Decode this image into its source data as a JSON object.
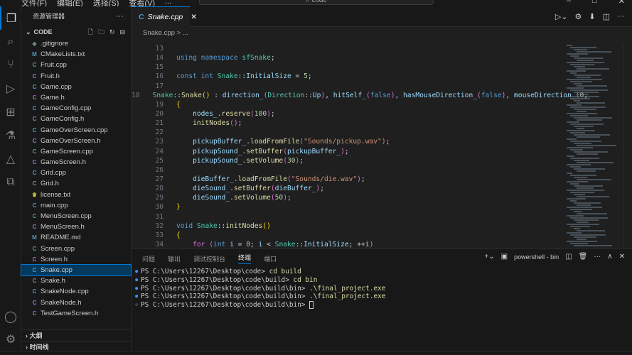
{
  "menu": [
    "文件(F)",
    "编辑(E)",
    "选择(S)",
    "查看(V)",
    "..."
  ],
  "search": "code",
  "sidebar": {
    "title": "资源管理器",
    "section": "CODE",
    "files": [
      {
        "name": ".gitignore",
        "icon": "git-icon"
      },
      {
        "name": "CMakeLists.txt",
        "icon": "cmake-icon"
      },
      {
        "name": "Fruit.cpp",
        "icon": "cpp-icon"
      },
      {
        "name": "Fruit.h",
        "icon": "c-header-icon"
      },
      {
        "name": "Game.cpp",
        "icon": "cpp-icon"
      },
      {
        "name": "Game.h",
        "icon": "c-header-icon"
      },
      {
        "name": "GameConfig.cpp",
        "icon": "cpp-icon"
      },
      {
        "name": "GameConfig.h",
        "icon": "c-header-icon"
      },
      {
        "name": "GameOverScreen.cpp",
        "icon": "cpp-icon"
      },
      {
        "name": "GameOverScreen.h",
        "icon": "c-header-icon"
      },
      {
        "name": "GameScreen.cpp",
        "icon": "cpp-icon"
      },
      {
        "name": "GameScreen.h",
        "icon": "c-header-icon"
      },
      {
        "name": "Grid.cpp",
        "icon": "cpp-icon"
      },
      {
        "name": "Grid.h",
        "icon": "c-header-icon"
      },
      {
        "name": "license.txt",
        "icon": "license-icon"
      },
      {
        "name": "main.cpp",
        "icon": "cpp-icon"
      },
      {
        "name": "MenuScreen.cpp",
        "icon": "cpp-icon"
      },
      {
        "name": "MenuScreen.h",
        "icon": "c-header-icon"
      },
      {
        "name": "README.md",
        "icon": "markdown-icon"
      },
      {
        "name": "Screen.cpp",
        "icon": "cpp-icon"
      },
      {
        "name": "Screen.h",
        "icon": "c-header-icon"
      },
      {
        "name": "Snake.cpp",
        "icon": "cpp-icon",
        "selected": true
      },
      {
        "name": "Snake.h",
        "icon": "c-header-icon"
      },
      {
        "name": "SnakeNode.cpp",
        "icon": "cpp-icon"
      },
      {
        "name": "SnakeNode.h",
        "icon": "c-header-icon"
      },
      {
        "name": "TestGameScreen.h",
        "icon": "c-header-icon"
      }
    ],
    "outline": "大纲",
    "timeline": "时间线"
  },
  "editor": {
    "tab": "Snake.cpp",
    "breadcrumb": "Snake.cpp > ...",
    "lines": [
      {
        "n": "13",
        "html": ""
      },
      {
        "n": "14",
        "html": "<span class='k'>using namespace</span> <span class='t'>sfSnake</span>;"
      },
      {
        "n": "15",
        "html": ""
      },
      {
        "n": "16",
        "html": "<span class='k'>const int</span> <span class='t'>Snake</span>::<span class='v'>InitialSize</span> = <span class='n'>5</span>;"
      },
      {
        "n": "17",
        "html": ""
      },
      {
        "n": "18",
        "html": "<span class='t'>Snake</span>::<span class='f'>Snake</span><span class='b'>()</span> : <span class='v'>direction_</span><span class='p'>(</span><span class='t'>Direction</span>::<span class='v'>Up</span><span class='p'>)</span>, <span class='v'>hitSelf_</span><span class='p'>(</span><span class='k'>false</span><span class='p'>)</span>, <span class='v'>hasMouseDirection_</span><span class='p'>(</span><span class='k'>false</span><span class='p'>)</span>, <span class='v'>mouseDirection_</span><span class='p'>(</span><span class='n'>0</span>,"
      },
      {
        "n": "19",
        "html": "<span class='b'>{</span>"
      },
      {
        "n": "20",
        "html": "    <span class='v'>nodes_</span>.<span class='f'>reserve</span><span class='p'>(</span><span class='n'>100</span><span class='p'>)</span>;"
      },
      {
        "n": "21",
        "html": "    <span class='f'>initNodes</span><span class='p'>()</span>;"
      },
      {
        "n": "22",
        "html": ""
      },
      {
        "n": "23",
        "html": "    <span class='v'>pickupBuffer_</span>.<span class='f'>loadFromFile</span><span class='p'>(</span><span class='s'>\"Sounds/pickup.wav\"</span><span class='p'>)</span>;"
      },
      {
        "n": "24",
        "html": "    <span class='v'>pickupSound_</span>.<span class='f'>setBuffer</span><span class='p'>(</span><span class='v'>pickupBuffer_</span><span class='p'>)</span>;"
      },
      {
        "n": "25",
        "html": "    <span class='v'>pickupSound_</span>.<span class='f'>setVolume</span><span class='p'>(</span><span class='n'>30</span><span class='p'>)</span>;"
      },
      {
        "n": "26",
        "html": ""
      },
      {
        "n": "27",
        "html": "    <span class='v'>dieBuffer_</span>.<span class='f'>loadFromFile</span><span class='p'>(</span><span class='s'>\"Sounds/die.wav\"</span><span class='p'>)</span>;"
      },
      {
        "n": "28",
        "html": "    <span class='v'>dieSound_</span>.<span class='f'>setBuffer</span><span class='p'>(</span><span class='v'>dieBuffer_</span><span class='p'>)</span>;"
      },
      {
        "n": "29",
        "html": "    <span class='v'>dieSound_</span>.<span class='f'>setVolume</span><span class='p'>(</span><span class='n'>50</span><span class='p'>)</span>;"
      },
      {
        "n": "30",
        "html": "<span class='b'>}</span>"
      },
      {
        "n": "31",
        "html": ""
      },
      {
        "n": "32",
        "html": "<span class='k'>void</span> <span class='t'>Snake</span>::<span class='f'>initNodes</span><span class='b'>()</span>"
      },
      {
        "n": "33",
        "html": "<span class='b'>{</span>"
      },
      {
        "n": "34",
        "html": "    <span class='p'>for</span> <span class='p'>(</span><span class='k'>int</span> <span class='v'>i</span> = <span class='n'>0</span>; <span class='v'>i</span> &lt; <span class='t'>Snake</span>::<span class='v'>InitialSize</span>; ++<span class='v'>i</span><span class='p'>)</span>"
      }
    ]
  },
  "panel": {
    "tabs": [
      "问题",
      "输出",
      "调试控制台",
      "终端",
      "端口"
    ],
    "active": "终端",
    "shell": "powershell - bin",
    "lines": [
      {
        "prompt": "PS C:\\Users\\12267\\Desktop\\code> ",
        "cmd": "cd build"
      },
      {
        "prompt": "PS C:\\Users\\12267\\Desktop\\code\\build> ",
        "cmd": "cd bin"
      },
      {
        "prompt": "PS C:\\Users\\12267\\Desktop\\code\\build\\bin> ",
        "cmd": ".\\final_project.exe"
      },
      {
        "prompt": "PS C:\\Users\\12267\\Desktop\\code\\build\\bin> ",
        "cmd": ".\\final_project.exe"
      },
      {
        "prompt": "PS C:\\Users\\12267\\Desktop\\code\\build\\bin> ",
        "cmd": ""
      }
    ]
  },
  "colors": {
    "accent": "#0078d4",
    "selection": "#04395e"
  }
}
